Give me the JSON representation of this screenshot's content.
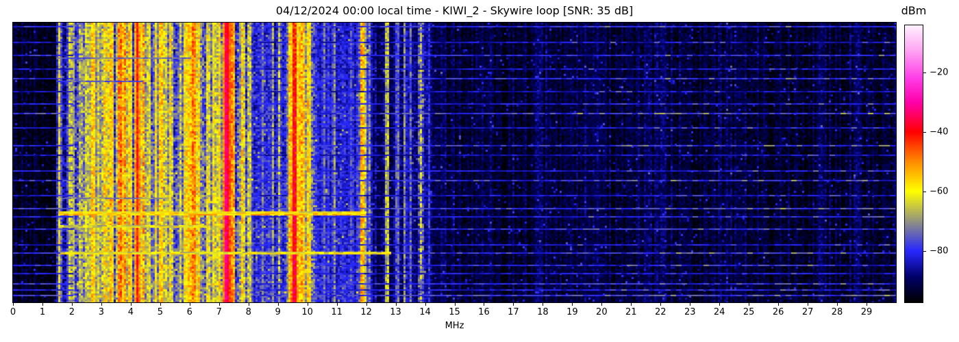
{
  "chart_data": {
    "type": "heatmap",
    "variant": "radio-spectrum-waterfall",
    "title": "04/12/2024 00:00 local time - KIWI_2 - Skywire loop [SNR: 35 dB]",
    "station": "KIWI_2",
    "antenna": "Skywire loop",
    "snr_label": "SNR: 35 dB",
    "xlabel": "MHz",
    "x_range_mhz": [
      0,
      30
    ],
    "x_ticks": [
      0,
      1,
      2,
      3,
      4,
      5,
      6,
      7,
      8,
      9,
      10,
      11,
      12,
      13,
      14,
      15,
      16,
      17,
      18,
      19,
      20,
      21,
      22,
      23,
      24,
      25,
      26,
      27,
      28,
      29
    ],
    "y_ticks": [],
    "colorbar": {
      "label": "dBm",
      "tick_values": [
        -20,
        -40,
        -60,
        -80
      ],
      "tick_labels": [
        "−20",
        "−40",
        "−60",
        "−80"
      ],
      "vmin": -97.3,
      "vmax": -4.1
    },
    "colormap_stops": [
      [
        -97.3,
        "#000000"
      ],
      [
        -89.0,
        "#000066"
      ],
      [
        -80.0,
        "#2828ff"
      ],
      [
        -60.0,
        "#ffff00"
      ],
      [
        -50.0,
        "#ff8c00"
      ],
      [
        -40.0,
        "#ff0000"
      ],
      [
        -30.0,
        "#ff00aa"
      ],
      [
        -22.0,
        "#ff3ce6"
      ],
      [
        -12.0,
        "#ffaaf4"
      ],
      [
        -4.1,
        "#fff0ff"
      ]
    ],
    "noise_seed": 42,
    "background_bands": [
      {
        "f0": 0.0,
        "f1": 1.45,
        "dbm": -94.0,
        "var": 3.5,
        "slope": 0
      },
      {
        "f0": 1.45,
        "f1": 2.05,
        "dbm": -85.0,
        "var": 7.0,
        "slope": 2
      },
      {
        "f0": 2.05,
        "f1": 8.1,
        "dbm": -78.0,
        "var": 9.0,
        "slope": 4
      },
      {
        "f0": 8.1,
        "f1": 9.35,
        "dbm": -82.0,
        "var": 6.0,
        "slope": 3
      },
      {
        "f0": 9.35,
        "f1": 10.25,
        "dbm": -79.0,
        "var": 9.0,
        "slope": 4
      },
      {
        "f0": 10.25,
        "f1": 12.2,
        "dbm": -83.0,
        "var": 5.0,
        "slope": 2
      },
      {
        "f0": 12.2,
        "f1": 14.35,
        "dbm": -89.0,
        "var": 4.0,
        "slope": 0
      },
      {
        "f0": 14.35,
        "f1": 30.0,
        "dbm": -92.5,
        "var": 3.5,
        "slope": 0
      }
    ],
    "carriers": [
      {
        "f": 1.58,
        "w": 0.05,
        "dbm": -63,
        "var": 7
      },
      {
        "f": 1.93,
        "w": 0.05,
        "dbm": -62,
        "var": 7
      },
      {
        "f": 2.02,
        "w": 0.05,
        "dbm": -65,
        "var": 7
      },
      {
        "f": 2.3,
        "w": 0.07,
        "dbm": -70,
        "var": 8
      },
      {
        "f": 2.5,
        "w": 0.06,
        "dbm": -63,
        "var": 7
      },
      {
        "f": 2.72,
        "w": 0.12,
        "dbm": -57,
        "var": 6
      },
      {
        "f": 2.92,
        "w": 0.05,
        "dbm": -64,
        "var": 8
      },
      {
        "f": 3.2,
        "w": 0.28,
        "dbm": -61,
        "var": 9
      },
      {
        "f": 3.33,
        "w": 0.06,
        "dbm": -53,
        "var": 8
      },
      {
        "f": 3.62,
        "w": 0.08,
        "dbm": -48,
        "var": 7
      },
      {
        "f": 3.78,
        "w": 0.07,
        "dbm": -52,
        "var": 8
      },
      {
        "f": 3.95,
        "w": 0.1,
        "dbm": -57,
        "var": 7
      },
      {
        "f": 4.22,
        "w": 0.07,
        "dbm": -42,
        "var": 5
      },
      {
        "f": 4.42,
        "w": 0.06,
        "dbm": -52,
        "var": 8
      },
      {
        "f": 4.62,
        "w": 0.06,
        "dbm": -61,
        "var": 7
      },
      {
        "f": 4.85,
        "w": 0.05,
        "dbm": -63,
        "var": 7
      },
      {
        "f": 5.02,
        "w": 0.1,
        "dbm": -55,
        "var": 7
      },
      {
        "f": 5.17,
        "w": 0.05,
        "dbm": -62,
        "var": 8
      },
      {
        "f": 5.35,
        "w": 0.07,
        "dbm": -60,
        "var": 8
      },
      {
        "f": 5.68,
        "w": 0.06,
        "dbm": -67,
        "var": 8
      },
      {
        "f": 5.95,
        "w": 0.28,
        "dbm": -57,
        "var": 8
      },
      {
        "f": 6.12,
        "w": 0.08,
        "dbm": -49,
        "var": 7
      },
      {
        "f": 6.3,
        "w": 0.06,
        "dbm": -56,
        "var": 8
      },
      {
        "f": 6.62,
        "w": 0.05,
        "dbm": -61,
        "var": 8
      },
      {
        "f": 6.82,
        "w": 0.05,
        "dbm": -58,
        "var": 8
      },
      {
        "f": 7.0,
        "w": 0.06,
        "dbm": -60,
        "var": 8
      },
      {
        "f": 7.26,
        "w": 0.13,
        "dbm": -37,
        "var": 4,
        "slope": 3
      },
      {
        "f": 7.46,
        "w": 0.08,
        "dbm": -52,
        "var": 7
      },
      {
        "f": 7.8,
        "w": 0.06,
        "dbm": -58,
        "var": 8
      },
      {
        "f": 8.02,
        "w": 0.05,
        "dbm": -63,
        "var": 8
      },
      {
        "f": 8.47,
        "w": 0.05,
        "dbm": -71,
        "var": 6
      },
      {
        "f": 8.8,
        "w": 0.04,
        "dbm": -70,
        "var": 6
      },
      {
        "f": 9.05,
        "w": 0.04,
        "dbm": -68,
        "var": 7
      },
      {
        "f": 9.4,
        "w": 0.05,
        "dbm": -57,
        "var": 8
      },
      {
        "f": 9.56,
        "w": 0.09,
        "dbm": -41,
        "var": 6,
        "slope": 7
      },
      {
        "f": 9.78,
        "w": 0.2,
        "dbm": -56,
        "var": 8
      },
      {
        "f": 10.02,
        "w": 0.08,
        "dbm": -57,
        "var": 8
      },
      {
        "f": 10.55,
        "w": 0.04,
        "dbm": -74,
        "var": 6
      },
      {
        "f": 10.9,
        "w": 0.04,
        "dbm": -72,
        "var": 6
      },
      {
        "f": 11.45,
        "w": 0.04,
        "dbm": -77,
        "var": 6
      },
      {
        "f": 11.87,
        "w": 0.11,
        "dbm": -55,
        "var": 7
      },
      {
        "f": 12.1,
        "w": 0.05,
        "dbm": -70,
        "var": 8
      },
      {
        "f": 12.7,
        "w": 0.04,
        "dbm": -62,
        "var": 7
      },
      {
        "f": 13.05,
        "w": 0.04,
        "dbm": -72,
        "var": 6
      },
      {
        "f": 13.3,
        "w": 0.04,
        "dbm": -70,
        "var": 6
      },
      {
        "f": 13.5,
        "w": 0.04,
        "dbm": -73,
        "var": 6
      },
      {
        "f": 13.85,
        "w": 0.05,
        "dbm": -64,
        "var": 10
      },
      {
        "f": 14.12,
        "w": 0.04,
        "dbm": -78,
        "var": 6
      }
    ],
    "horizontal_lines": [
      {
        "y": 0.012,
        "dbm": -80,
        "var": 4
      },
      {
        "y": 0.07,
        "dbm": -84,
        "var": 4
      },
      {
        "y": 0.115,
        "dbm": -81,
        "var": 5
      },
      {
        "y": 0.165,
        "dbm": -84,
        "var": 4
      },
      {
        "y": 0.2,
        "dbm": -80,
        "var": 5
      },
      {
        "y": 0.245,
        "dbm": -84,
        "var": 4
      },
      {
        "y": 0.29,
        "dbm": -82,
        "var": 4
      },
      {
        "y": 0.325,
        "dbm": -78,
        "var": 6
      },
      {
        "y": 0.375,
        "dbm": -83,
        "var": 4
      },
      {
        "y": 0.44,
        "dbm": -80,
        "var": 5
      },
      {
        "y": 0.475,
        "dbm": -84,
        "var": 4
      },
      {
        "y": 0.53,
        "dbm": -82,
        "var": 4
      },
      {
        "y": 0.565,
        "dbm": -79,
        "var": 6
      },
      {
        "y": 0.62,
        "dbm": -83,
        "var": 4
      },
      {
        "y": 0.665,
        "dbm": -78,
        "var": 5
      },
      {
        "y": 0.695,
        "dbm": -82,
        "var": 4
      },
      {
        "y": 0.74,
        "dbm": -80,
        "var": 5
      },
      {
        "y": 0.795,
        "dbm": -83,
        "var": 4
      },
      {
        "y": 0.825,
        "dbm": -79,
        "var": 5
      },
      {
        "y": 0.87,
        "dbm": -81,
        "var": 5
      },
      {
        "y": 0.9,
        "dbm": -83,
        "var": 4
      },
      {
        "y": 0.935,
        "dbm": -80,
        "var": 5
      },
      {
        "y": 0.958,
        "dbm": -82,
        "var": 4
      },
      {
        "y": 0.978,
        "dbm": -78,
        "var": 5
      }
    ],
    "noise_bursts": [
      {
        "y": 0.125,
        "f0": 1.5,
        "f1": 6.0,
        "dbm": -73,
        "var": 5,
        "rows": 1
      },
      {
        "y": 0.21,
        "f0": 1.5,
        "f1": 4.3,
        "dbm": -75,
        "var": 5,
        "rows": 1
      },
      {
        "y": 0.63,
        "f0": 1.5,
        "f1": 5.2,
        "dbm": -71,
        "var": 5,
        "rows": 1
      },
      {
        "y": 0.677,
        "f0": 1.55,
        "f1": 11.9,
        "dbm": -61,
        "var": 6,
        "rows": 3
      },
      {
        "y": 0.728,
        "f0": 1.55,
        "f1": 6.5,
        "dbm": -65,
        "var": 6,
        "rows": 2
      },
      {
        "y": 0.824,
        "f0": 1.6,
        "f1": 12.7,
        "dbm": -63,
        "var": 6,
        "rows": 2
      }
    ]
  }
}
